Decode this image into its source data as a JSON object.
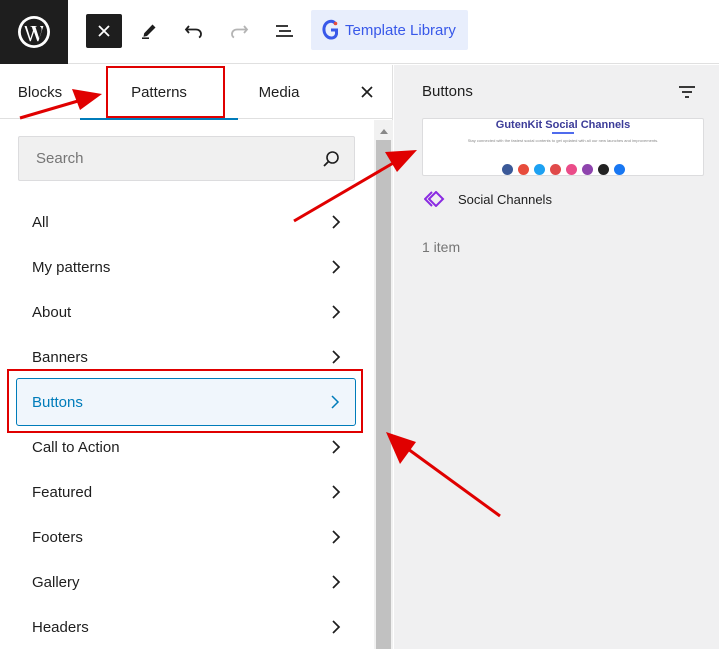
{
  "toolbar": {
    "template_library_label": "Template Library"
  },
  "inserter": {
    "tabs": [
      {
        "label": "Blocks"
      },
      {
        "label": "Patterns"
      },
      {
        "label": "Media"
      }
    ],
    "search_placeholder": "Search",
    "categories": [
      {
        "label": "All"
      },
      {
        "label": "My patterns"
      },
      {
        "label": "About"
      },
      {
        "label": "Banners"
      },
      {
        "label": "Buttons"
      },
      {
        "label": "Call to Action"
      },
      {
        "label": "Featured"
      },
      {
        "label": "Footers"
      },
      {
        "label": "Gallery"
      },
      {
        "label": "Headers"
      }
    ],
    "active_category": "Buttons"
  },
  "preview": {
    "title": "Buttons",
    "pattern": {
      "thumbnail_title": "GutenKit Social Channels",
      "thumbnail_subtitle": "Stay connected with the fastest social contents to get updated with all our new launches and improvements.",
      "name": "Social Channels"
    },
    "count": "1 item"
  },
  "colors": {
    "accent": "#007cba",
    "template_library": "#3858e9",
    "annotation": "#e00000",
    "social_dots": [
      "#3b5998",
      "#e74c3c",
      "#1da1f2",
      "#e04a4a",
      "#ea4c89",
      "#8e44ad",
      "#222222",
      "#1877f2"
    ]
  }
}
